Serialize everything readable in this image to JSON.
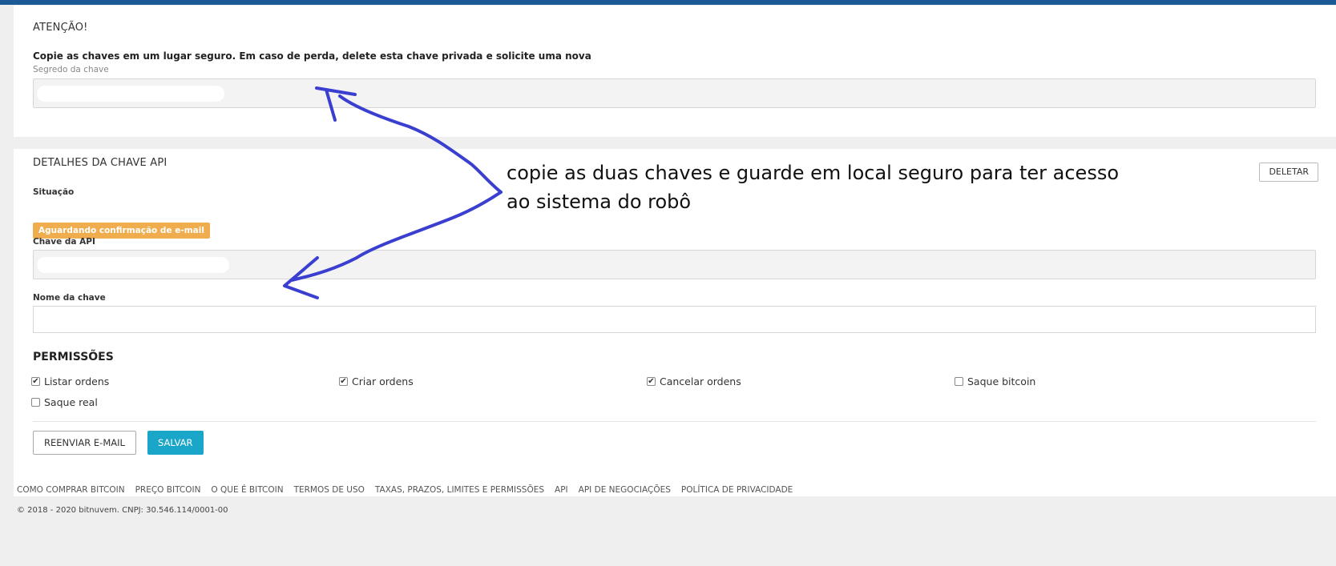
{
  "warning": {
    "title": "ATENÇÃO!",
    "note": "Copie as chaves em um lugar seguro. Em caso de perda, delete esta chave privada e solicite uma nova",
    "secret_label": "Segredo da chave",
    "secret_value": ""
  },
  "details": {
    "title": "DETALHES DA CHAVE API",
    "delete_label": "DELETAR",
    "status_label": "Situação",
    "status_badge": "Aguardando confirmação de e-mail",
    "api_key_label": "Chave da API",
    "api_key_value": "",
    "name_label": "Nome da chave",
    "name_value": "",
    "permissions_title": "PERMISSÕES",
    "permissions": [
      {
        "label": "Listar ordens",
        "checked": true
      },
      {
        "label": "Criar ordens",
        "checked": true
      },
      {
        "label": "Cancelar ordens",
        "checked": true
      },
      {
        "label": "Saque bitcoin",
        "checked": false
      },
      {
        "label": "Saque real",
        "checked": false
      }
    ],
    "resend_label": "REENVIAR E-MAIL",
    "save_label": "SALVAR"
  },
  "annotation": {
    "text": "copie as duas chaves e guarde em local seguro para ter acesso\nao sistema do robô",
    "color": "#3a3fd0"
  },
  "footer": {
    "links": [
      "COMO COMPRAR BITCOIN",
      "PREÇO BITCOIN",
      "O QUE É BITCOIN",
      "TERMOS DE USO",
      "TAXAS, PRAZOS, LIMITES E PERMISSÕES",
      "API",
      "API DE NEGOCIAÇÕES",
      "POLÍTICA DE PRIVACIDADE"
    ],
    "copyright": "© 2018 - 2020 bitnuvem. CNPJ: 30.546.114/0001-00"
  },
  "colors": {
    "topbar": "#1b5a96",
    "badge": "#f0ad4e",
    "save_button": "#1aa6c8"
  }
}
